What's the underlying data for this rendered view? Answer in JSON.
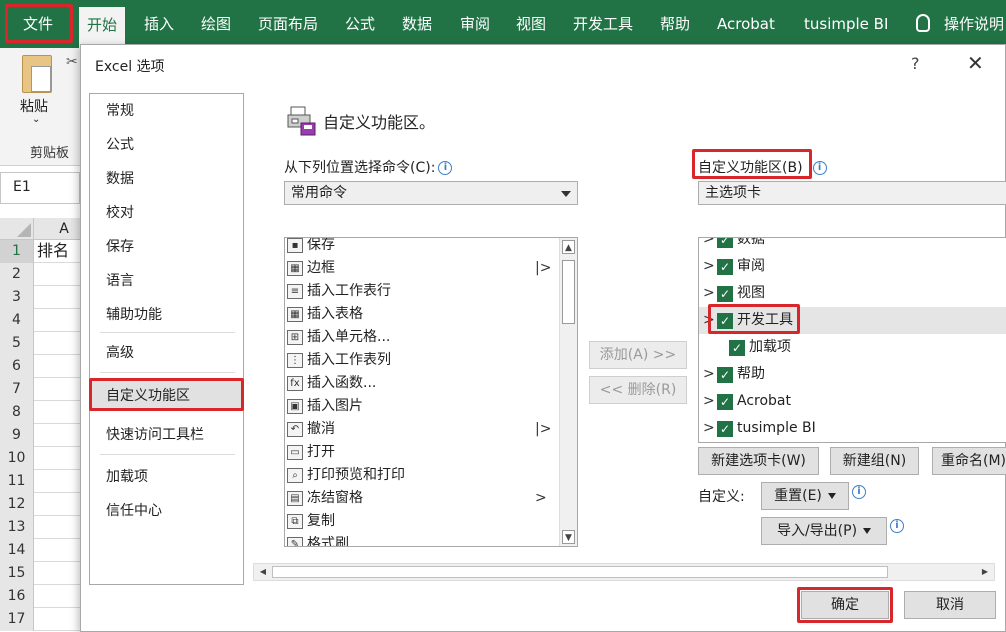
{
  "ribbon": {
    "tabs": [
      "文件",
      "开始",
      "插入",
      "绘图",
      "页面布局",
      "公式",
      "数据",
      "审阅",
      "视图",
      "开发工具",
      "帮助",
      "Acrobat",
      "tusimple BI"
    ],
    "tell_me": "操作说明",
    "colors": {
      "brand": "#217346",
      "highlight": "#d9262b"
    }
  },
  "clipboard": {
    "paste": "粘贴",
    "group": "剪贴板"
  },
  "name_box": "E1",
  "sheet": {
    "col": "A",
    "rows": [
      "1",
      "2",
      "3",
      "4",
      "5",
      "6",
      "7",
      "8",
      "9",
      "10",
      "11",
      "12",
      "13",
      "14",
      "15",
      "16",
      "17"
    ],
    "a1": "排名"
  },
  "dialog": {
    "title": "Excel 选项",
    "help": "?",
    "close": "✕",
    "nav": [
      "常规",
      "公式",
      "数据",
      "校对",
      "保存",
      "语言",
      "辅助功能",
      "高级",
      "自定义功能区",
      "快速访问工具栏",
      "加载项",
      "信任中心"
    ],
    "section_title": "自定义功能区。",
    "choose_label": "从下列位置选择命令(C):",
    "choose_value": "常用命令",
    "customize_label": "自定义功能区(B)",
    "customize_value": "主选项卡",
    "commands": [
      {
        "icon": "save-icon",
        "glyph": "▪",
        "label": "保存",
        "sub": ""
      },
      {
        "icon": "border-icon",
        "glyph": "▦",
        "label": "边框",
        "sub": "|>"
      },
      {
        "icon": "insert-row-icon",
        "glyph": "≡",
        "label": "插入工作表行",
        "sub": ""
      },
      {
        "icon": "table-icon",
        "glyph": "▦",
        "label": "插入表格",
        "sub": ""
      },
      {
        "icon": "insert-cell-icon",
        "glyph": "⊞",
        "label": "插入单元格...",
        "sub": ""
      },
      {
        "icon": "insert-column-icon",
        "glyph": "⋮",
        "label": "插入工作表列",
        "sub": ""
      },
      {
        "icon": "function-icon",
        "glyph": "fx",
        "label": "插入函数...",
        "sub": ""
      },
      {
        "icon": "picture-icon",
        "glyph": "▣",
        "label": "插入图片",
        "sub": ""
      },
      {
        "icon": "undo-icon",
        "glyph": "↶",
        "label": "撤消",
        "sub": "|>"
      },
      {
        "icon": "open-icon",
        "glyph": "▭",
        "label": "打开",
        "sub": ""
      },
      {
        "icon": "print-preview-icon",
        "glyph": "⌕",
        "label": "打印预览和打印",
        "sub": ""
      },
      {
        "icon": "freeze-panes-icon",
        "glyph": "▤",
        "label": "冻结窗格",
        "sub": ">"
      },
      {
        "icon": "copy-icon",
        "glyph": "⧉",
        "label": "复制",
        "sub": ""
      },
      {
        "icon": "format-painter-icon",
        "glyph": "✎",
        "label": "格式刷",
        "sub": ""
      }
    ],
    "add_button": "添加(A) >>",
    "remove_button": "<< 删除(R)",
    "tree": [
      {
        "label": "数据",
        "check": true,
        "exp": ">"
      },
      {
        "label": "审阅",
        "check": true,
        "exp": ">"
      },
      {
        "label": "视图",
        "check": true,
        "exp": ">"
      },
      {
        "label": "开发工具",
        "check": true,
        "exp": ">"
      },
      {
        "label": "加载项",
        "check": true,
        "exp": ""
      },
      {
        "label": "帮助",
        "check": true,
        "exp": ">"
      },
      {
        "label": "Acrobat",
        "check": true,
        "exp": ">"
      },
      {
        "label": "tusimple BI",
        "check": true,
        "exp": ">"
      }
    ],
    "new_tab": "新建选项卡(W)",
    "new_group": "新建组(N)",
    "rename": "重命名(M)...",
    "custom_label": "自定义:",
    "reset": "重置(E)",
    "import_export": "导入/导出(P)",
    "ok": "确定",
    "cancel": "取消"
  }
}
